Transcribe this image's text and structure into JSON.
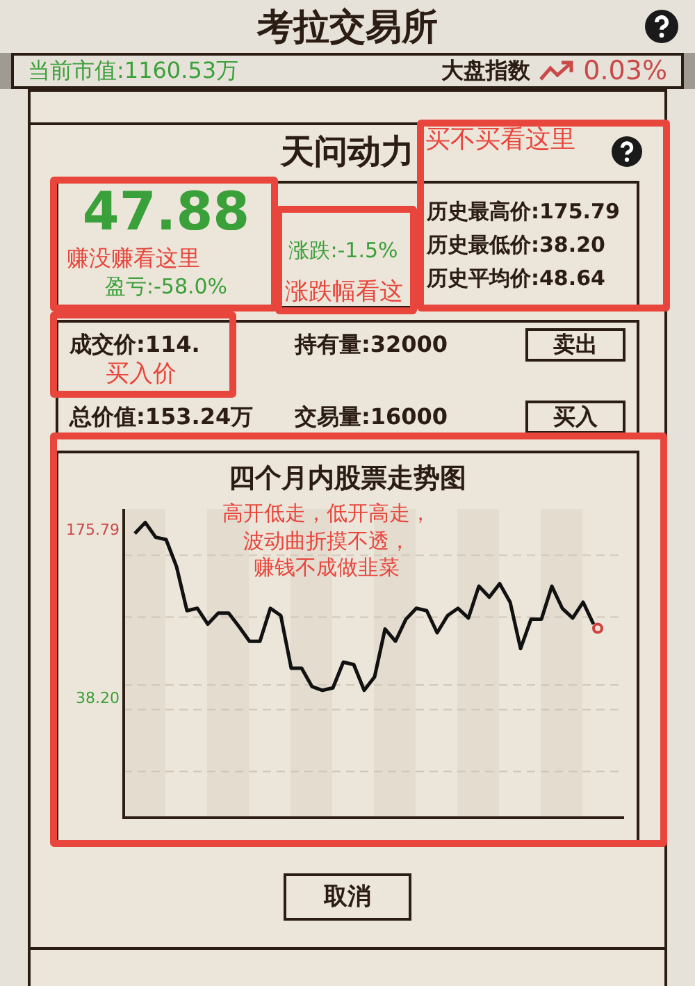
{
  "header": {
    "title": "考拉交易所"
  },
  "info": {
    "market_value": "当前市值:1160.53万",
    "index_label": "大盘指数",
    "index_change": "0.03%"
  },
  "dialog": {
    "title": "天问动力",
    "stock": {
      "price": "47.88",
      "profit": "盈亏:-58.0%",
      "change": "涨跌:-1.5%",
      "history": [
        "历史最高价:175.79",
        "历史最低价:38.20",
        "历史平均价:48.64"
      ]
    },
    "trade": {
      "rows": [
        {
          "left": "成交价:114.",
          "right": "持有量:32000",
          "button": "卖出"
        },
        {
          "left": "总价值:153.24万",
          "right": "交易量:16000",
          "button": "买入"
        }
      ]
    },
    "chart_data": {
      "type": "line",
      "title": "四个月内股票走势图",
      "ylim": [
        -60,
        192
      ],
      "yticks": [
        {
          "value": 38.2,
          "label": "38.20"
        },
        {
          "value": 175.79,
          "label": "175.79"
        }
      ],
      "series": [
        {
          "color": "#111111",
          "values": [
            172,
            181,
            169,
            167,
            145,
            109,
            111,
            98,
            107,
            107,
            96,
            84,
            84,
            111,
            105,
            62,
            62,
            47,
            44,
            46,
            67,
            65,
            44,
            55,
            94,
            84,
            102,
            111,
            109,
            91,
            105,
            111,
            103,
            129,
            120,
            131,
            116,
            78,
            102,
            102,
            129,
            111,
            103,
            116,
            98
          ]
        }
      ]
    },
    "cancel": "取消"
  },
  "annotations": [
    {
      "text": "买不买看这里"
    },
    {
      "text": "赚没赚看这里"
    },
    {
      "text": "涨跌幅看这"
    },
    {
      "text": "买入价"
    },
    {
      "lines": [
        "高开低走，低开高走，",
        "波动曲折摸不透，",
        "赚钱不成做韭菜"
      ]
    }
  ]
}
